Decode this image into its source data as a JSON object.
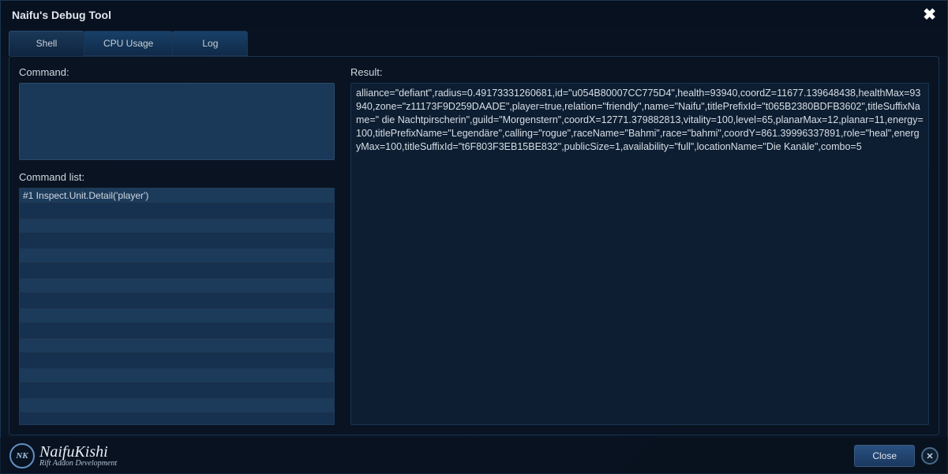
{
  "window": {
    "title": "Naifu's Debug Tool"
  },
  "tabs": [
    {
      "label": "Shell",
      "active": true
    },
    {
      "label": "CPU Usage",
      "active": false
    },
    {
      "label": "Log",
      "active": false
    }
  ],
  "labels": {
    "command": "Command:",
    "commandList": "Command list:",
    "result": "Result:"
  },
  "commandList": [
    "#1 Inspect.Unit.Detail('player')"
  ],
  "result": "alliance=\"defiant\",radius=0.49173331260681,id=\"u054B80007CC775D4\",health=93940,coordZ=11677.139648438,healthMax=93940,zone=\"z11173F9D259DAADE\",player=true,relation=\"friendly\",name=\"Naifu\",titlePrefixId=\"t065B2380BDFB3602\",titleSuffixName=\" die Nachtpirscherin\",guild=\"Morgenstern\",coordX=12771.379882813,vitality=100,level=65,planarMax=12,planar=11,energy=100,titlePrefixName=\"Legendäre\",calling=\"rogue\",raceName=\"Bahmi\",race=\"bahmi\",coordY=861.39996337891,role=\"heal\",energyMax=100,titleSuffixId=\"t6F803F3EB15BE832\",publicSize=1,availability=\"full\",locationName=\"Die Kanäle\",combo=5",
  "footer": {
    "logoInitials": "NK",
    "logoName": "NaifuKishi",
    "logoSub": "Rift Addon Development",
    "closeLabel": "Close"
  }
}
